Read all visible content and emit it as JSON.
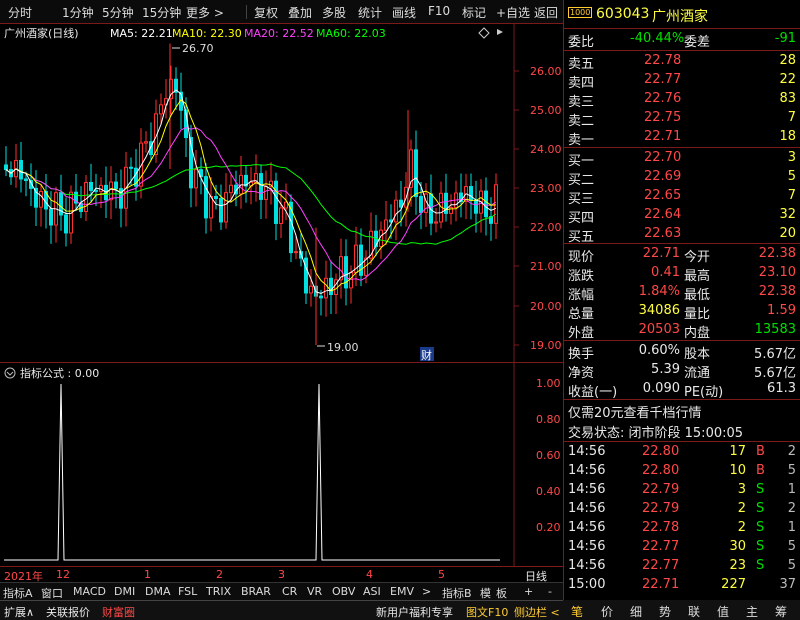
{
  "toolbar": {
    "items": [
      "分时",
      "1分钟",
      "5分钟",
      "15分钟",
      "更多 >",
      "复权",
      "叠加",
      "多股",
      "统计",
      "画线",
      "F10",
      "标记",
      "+自选",
      "返回"
    ]
  },
  "chart": {
    "stock_name": "广州酒家(日线)",
    "ma5": "MA5: 22.21",
    "ma10": "MA10: 22.30",
    "ma20": "MA20: 22.52",
    "ma60": "MA60: 22.03",
    "y_labels": [
      "26.00",
      "25.00",
      "24.00",
      "23.00",
      "22.00",
      "21.00",
      "20.00",
      "19.00"
    ],
    "high_mark": "26.70",
    "low_mark": "19.00",
    "fin_badge": "财",
    "colors": {
      "up": "#ff3030",
      "down": "#00e0e0",
      "ma5": "#ffffff",
      "ma10": "#ffff00",
      "ma20": "#ff40ff",
      "ma60": "#00ff00",
      "axis": "#7a1a1a"
    }
  },
  "indicator": {
    "title": "指标公式 : 0.00",
    "y_labels": [
      "1.00",
      "0.80",
      "0.60",
      "0.40",
      "0.20"
    ]
  },
  "dates": {
    "labels": [
      "2021年",
      "12",
      "1",
      "2",
      "3",
      "4",
      "5"
    ],
    "right": "日线"
  },
  "ind_tabs": {
    "items": [
      "指标A",
      "窗口",
      "MACD",
      "DMI",
      "DMA",
      "FSL",
      "TRIX",
      "BRAR",
      "CR",
      "VR",
      "OBV",
      "ASI",
      "EMV",
      ">",
      "指标B",
      "模",
      "板",
      "+",
      "-"
    ]
  },
  "status_bar": {
    "expand": "扩展∧",
    "related": "关联报价",
    "fortune": "财富圈",
    "promo": "新用户福利专享",
    "f10": "图文F10",
    "sidebar": "侧边栏 <"
  },
  "panel": {
    "code": "603043",
    "name": "广州酒家",
    "code_badge": "1000",
    "weibi_label": "委比",
    "weibi_value": "-40.44%",
    "weicha_label": "委差",
    "weicha_value": "-91",
    "asks": [
      {
        "label": "卖五",
        "price": "22.78",
        "vol": "28"
      },
      {
        "label": "卖四",
        "price": "22.77",
        "vol": "22"
      },
      {
        "label": "卖三",
        "price": "22.76",
        "vol": "83"
      },
      {
        "label": "卖二",
        "price": "22.75",
        "vol": "7"
      },
      {
        "label": "卖一",
        "price": "22.71",
        "vol": "18"
      }
    ],
    "bids": [
      {
        "label": "买一",
        "price": "22.70",
        "vol": "3"
      },
      {
        "label": "买二",
        "price": "22.69",
        "vol": "5"
      },
      {
        "label": "买三",
        "price": "22.65",
        "vol": "7"
      },
      {
        "label": "买四",
        "price": "22.64",
        "vol": "32"
      },
      {
        "label": "买五",
        "price": "22.63",
        "vol": "20"
      }
    ],
    "quote": [
      {
        "l1": "现价",
        "v1": "22.71",
        "l2": "今开",
        "v2": "22.38"
      },
      {
        "l1": "涨跌",
        "v1": "0.41",
        "l2": "最高",
        "v2": "23.10"
      },
      {
        "l1": "涨幅",
        "v1": "1.84%",
        "l2": "最低",
        "v2": "22.38"
      },
      {
        "l1": "总量",
        "v1": "34086",
        "l2": "量比",
        "v2": "1.59"
      },
      {
        "l1": "外盘",
        "v1": "20503",
        "l2": "内盘",
        "v2": "13583"
      }
    ],
    "fund": [
      {
        "l1": "换手",
        "v1": "0.60%",
        "l2": "股本",
        "v2": "5.67亿"
      },
      {
        "l1": "净资",
        "v1": "5.39",
        "l2": "流通",
        "v2": "5.67亿"
      },
      {
        "l1": "收益(一)",
        "v1": "0.090",
        "l2": "PE(动)",
        "v2": "61.3"
      }
    ],
    "promo": "仅需20元查看千档行情",
    "trade_state": "交易状态: 闭市阶段 15:00:05",
    "ticks": [
      {
        "time": "14:56",
        "price": "22.80",
        "vol": "17",
        "side": "B",
        "n": "2"
      },
      {
        "time": "14:56",
        "price": "22.80",
        "vol": "10",
        "side": "B",
        "n": "5"
      },
      {
        "time": "14:56",
        "price": "22.79",
        "vol": "3",
        "side": "S",
        "n": "1"
      },
      {
        "time": "14:56",
        "price": "22.79",
        "vol": "2",
        "side": "S",
        "n": "2"
      },
      {
        "time": "14:56",
        "price": "22.78",
        "vol": "2",
        "side": "S",
        "n": "1"
      },
      {
        "time": "14:56",
        "price": "22.77",
        "vol": "30",
        "side": "S",
        "n": "5"
      },
      {
        "time": "14:56",
        "price": "22.77",
        "vol": "23",
        "side": "S",
        "n": "5"
      },
      {
        "time": "15:00",
        "price": "22.71",
        "vol": "227",
        "side": "",
        "n": "37"
      }
    ]
  },
  "bottom_tabs": [
    "笔",
    "价",
    "细",
    "势",
    "联",
    "值",
    "主",
    "筹"
  ]
}
